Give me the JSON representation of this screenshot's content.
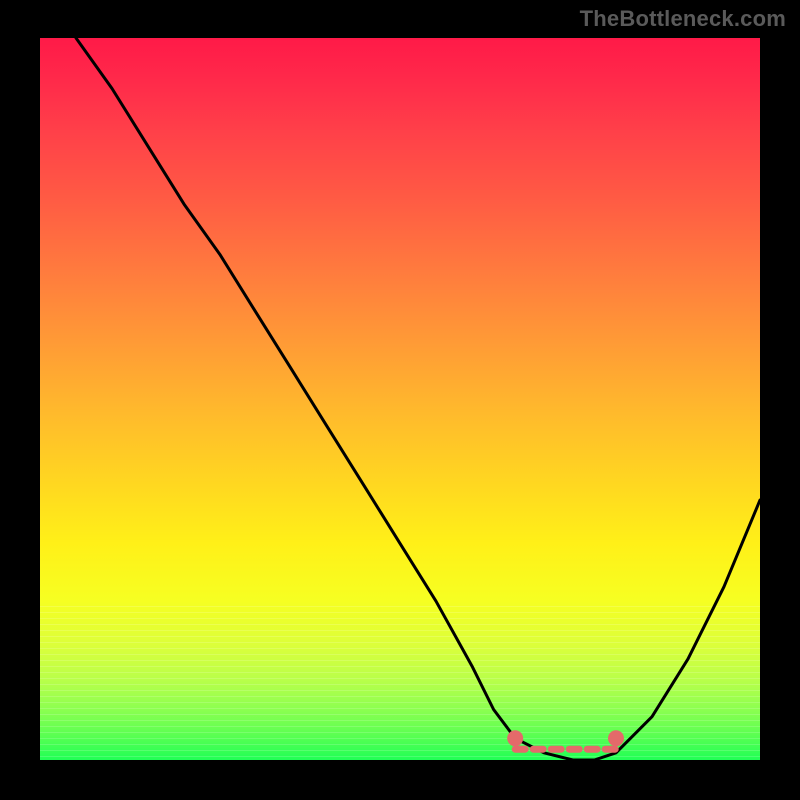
{
  "attribution": "TheBottleneck.com",
  "chart_data": {
    "type": "line",
    "title": "",
    "xlabel": "",
    "ylabel": "",
    "xlim": [
      0,
      100
    ],
    "ylim": [
      0,
      100
    ],
    "x": [
      5,
      10,
      15,
      20,
      25,
      30,
      35,
      40,
      45,
      50,
      55,
      60,
      63,
      66,
      70,
      74,
      77,
      80,
      85,
      90,
      95,
      100
    ],
    "values": [
      100,
      93,
      85,
      77,
      70,
      62,
      54,
      46,
      38,
      30,
      22,
      13,
      7,
      3,
      1,
      0,
      0,
      1,
      6,
      14,
      24,
      36
    ],
    "series": [
      {
        "name": "bottleneck-curve",
        "x": [
          5,
          10,
          15,
          20,
          25,
          30,
          35,
          40,
          45,
          50,
          55,
          60,
          63,
          66,
          70,
          74,
          77,
          80,
          85,
          90,
          95,
          100
        ],
        "values": [
          100,
          93,
          85,
          77,
          70,
          62,
          54,
          46,
          38,
          30,
          22,
          13,
          7,
          3,
          1,
          0,
          0,
          1,
          6,
          14,
          24,
          36
        ]
      }
    ],
    "optimal_range_x": [
      66,
      80
    ],
    "markers": [
      {
        "x": 66,
        "y": 3
      },
      {
        "x": 80,
        "y": 3
      }
    ],
    "colors": {
      "curve": "#000000",
      "marker": "#e46a6a",
      "optimal_tick": "#e46a6a",
      "gradient_top": "#ff1a48",
      "gradient_bottom": "#20ff55"
    }
  }
}
